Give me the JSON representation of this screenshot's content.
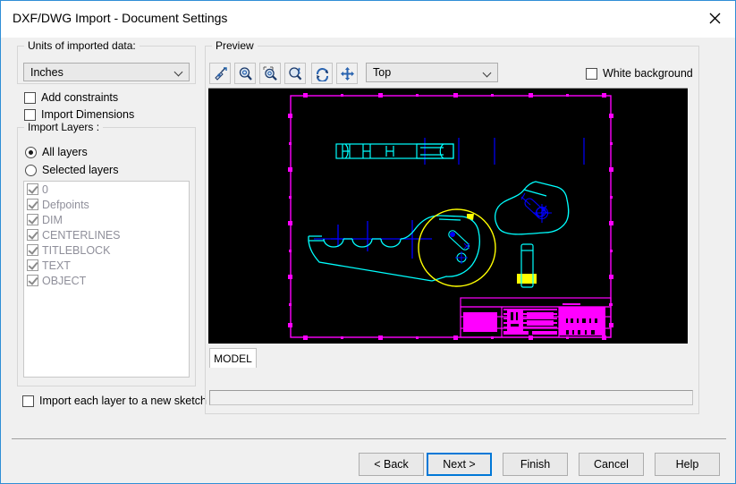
{
  "window": {
    "title": "DXF/DWG Import - Document Settings",
    "close_icon": "close-icon",
    "accent": "#2f8ed6",
    "background": "#f0f0f0"
  },
  "units_group": {
    "legend": "Units of imported data:",
    "combo_value": "Inches",
    "combo_arrow_icon": "chevron-down-icon"
  },
  "options": {
    "add_constraints": {
      "label": "Add constraints",
      "checked": false
    },
    "import_dimensions": {
      "label": "Import Dimensions",
      "checked": false
    },
    "import_each_layer": {
      "label": "Import each layer to a new sketch",
      "checked": false
    }
  },
  "import_layers": {
    "legend": "Import Layers :",
    "all_layers": {
      "label": "All layers",
      "selected": true
    },
    "selected_layers": {
      "label": "Selected layers",
      "selected": false
    },
    "layers": [
      {
        "name": "0",
        "checked": true
      },
      {
        "name": "Defpoints",
        "checked": true
      },
      {
        "name": "DIM",
        "checked": true
      },
      {
        "name": "CENTERLINES",
        "checked": true
      },
      {
        "name": "TITLEBLOCK",
        "checked": true
      },
      {
        "name": "TEXT",
        "checked": true
      },
      {
        "name": "OBJECT",
        "checked": true
      }
    ]
  },
  "preview": {
    "legend": "Preview",
    "toolbar": [
      {
        "name": "select-entities-icon",
        "title": "Select"
      },
      {
        "name": "zoom-in-icon",
        "title": "Zoom in"
      },
      {
        "name": "zoom-to-area-icon",
        "title": "Zoom to area"
      },
      {
        "name": "zoom-to-fit-icon",
        "title": "Zoom to fit"
      },
      {
        "name": "rotate-view-icon",
        "title": "Rotate"
      },
      {
        "name": "pan-view-icon",
        "title": "Pan"
      }
    ],
    "view_combo_value": "Top",
    "view_combo_arrow_icon": "chevron-down-icon",
    "white_background": {
      "label": "White background",
      "checked": false
    },
    "sheet_tab": "MODEL",
    "status_text": "",
    "canvas_colors": {
      "background": "#000000",
      "border": "#ff00ff",
      "object": "#00ffff",
      "centerline": "#0000ff",
      "highlight": "#ffff00",
      "titleblock": "#ff00ff"
    }
  },
  "footer": {
    "buttons": [
      {
        "label": "< Back",
        "name": "back-button",
        "focused": false
      },
      {
        "label": "Next >",
        "name": "next-button",
        "focused": true
      },
      {
        "label": "Finish",
        "name": "finish-button",
        "focused": false
      },
      {
        "label": "Cancel",
        "name": "cancel-button",
        "focused": false
      },
      {
        "label": "Help",
        "name": "help-button",
        "focused": false
      }
    ]
  }
}
